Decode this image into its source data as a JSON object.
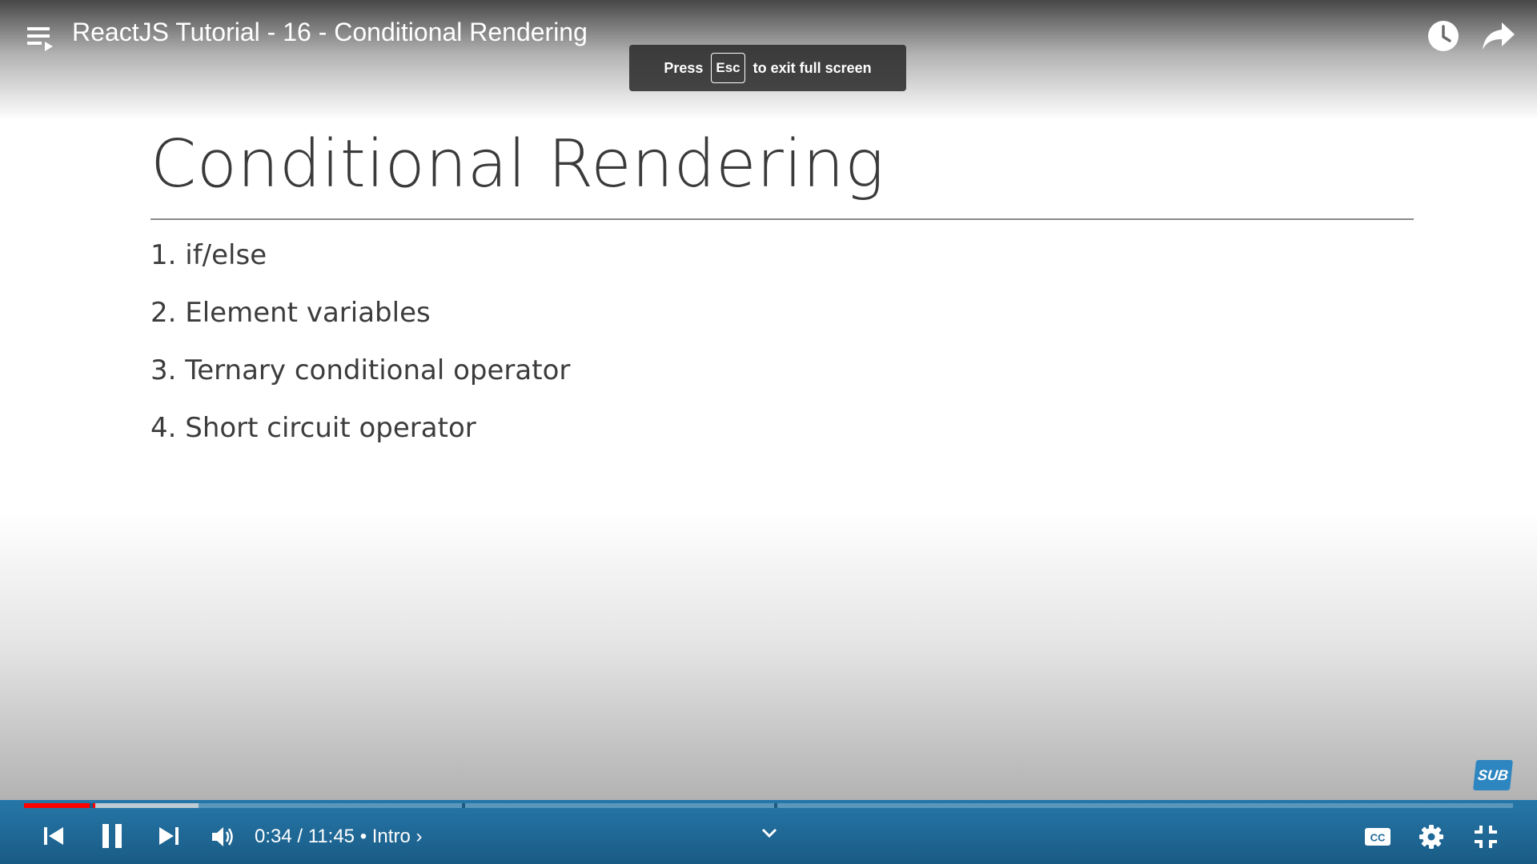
{
  "player": {
    "title": "ReactJS Tutorial - 16 - Conditional Rendering",
    "fullscreen_notice": {
      "prefix": "Press",
      "key": "Esc",
      "suffix": "to exit full screen"
    },
    "current_time": "0:34",
    "separator": "/",
    "duration": "11:45",
    "chapter_bullet": "•",
    "chapter": "Intro",
    "chapter_chevron": "›",
    "played_fraction": 0.048,
    "buffered_fraction": 0.117,
    "chapter_marks_fraction": [
      0.044,
      0.294,
      0.504
    ],
    "subscribe_badge": "SUB",
    "icons": {
      "playlist": "playlist-icon",
      "watch_later": "clock-icon",
      "share": "share-icon",
      "previous": "skip-previous-icon",
      "pause": "pause-icon",
      "next": "skip-next-icon",
      "volume": "volume-icon",
      "expand": "chevron-down-icon",
      "captions": "cc-icon",
      "settings": "gear-icon",
      "exit_fullscreen": "exit-fullscreen-icon"
    },
    "colors": {
      "progress": "#ff0000",
      "control_bar": "#1f6a99",
      "badge": "#2e86c1"
    }
  },
  "slide": {
    "title": "Conditional Rendering",
    "items": [
      "1. if/else",
      "2. Element variables",
      "3. Ternary conditional operator",
      "4. Short circuit operator"
    ]
  }
}
